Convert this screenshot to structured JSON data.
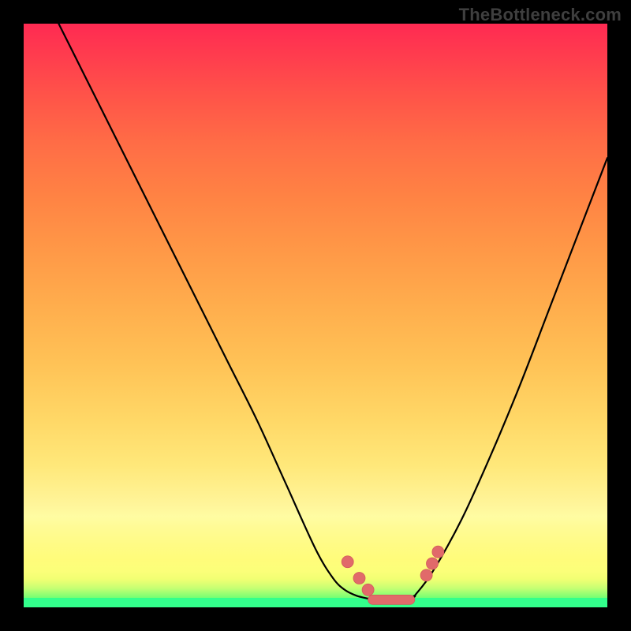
{
  "watermark": "TheBottleneck.com",
  "colors": {
    "frame": "#000000",
    "gradient_top": "#ff2a52",
    "gradient_mid": "#ffe87a",
    "gradient_bottom": "#33ff8c",
    "curve": "#000000",
    "beads": "#e16a6a"
  },
  "chart_data": {
    "type": "line",
    "title": "",
    "xlabel": "",
    "ylabel": "",
    "xlim": [
      0,
      100
    ],
    "ylim": [
      0,
      100
    ],
    "series": [
      {
        "name": "left-branch",
        "x": [
          6,
          10,
          15,
          20,
          25,
          30,
          35,
          40,
          45,
          50,
          53,
          55,
          57,
          59
        ],
        "y": [
          100,
          92,
          82,
          72,
          62,
          52,
          42,
          32,
          21,
          10,
          5,
          3,
          2,
          1.5
        ]
      },
      {
        "name": "valley-floor",
        "x": [
          59,
          61,
          63,
          65,
          67
        ],
        "y": [
          1.5,
          1.2,
          1.2,
          1.4,
          2
        ]
      },
      {
        "name": "right-branch",
        "x": [
          67,
          70,
          75,
          80,
          85,
          90,
          95,
          100
        ],
        "y": [
          2,
          6,
          15,
          26,
          38,
          51,
          64,
          77
        ]
      }
    ],
    "markers": [
      {
        "name": "left-bead-1",
        "x": 55.5,
        "y": 7.8
      },
      {
        "name": "left-bead-2",
        "x": 57.5,
        "y": 5.0
      },
      {
        "name": "left-bead-3",
        "x": 59.0,
        "y": 3.0
      },
      {
        "name": "right-bead-1",
        "x": 69.0,
        "y": 5.5
      },
      {
        "name": "right-bead-2",
        "x": 70.0,
        "y": 7.5
      },
      {
        "name": "right-bead-3",
        "x": 71.0,
        "y": 9.5
      }
    ],
    "bottom_pill": {
      "x0": 59,
      "x1": 67,
      "y": 1.3
    }
  }
}
